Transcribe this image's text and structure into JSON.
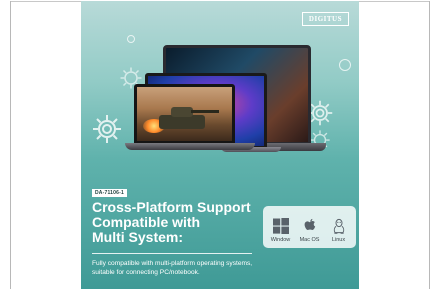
{
  "brand": {
    "logo": "DIGITUS"
  },
  "product": {
    "model": "DA-71106-1"
  },
  "headline": {
    "lines": [
      "Cross-Platform Support",
      "Compatible with",
      "Multi System:"
    ]
  },
  "description": {
    "lines": [
      "Fully compatible with multi-platform operating systems,",
      "suitable for connecting PC/notebook."
    ]
  },
  "os_support": [
    {
      "label": "Window",
      "icon": "windows-icon"
    },
    {
      "label": "Mac OS",
      "icon": "apple-icon"
    },
    {
      "label": "Linux",
      "icon": "linux-icon"
    }
  ],
  "colors": {
    "banner_top": "#b8dad8",
    "banner_bottom": "#3f9a96",
    "text": "#ffffff",
    "icon_gray": "#59626a"
  }
}
